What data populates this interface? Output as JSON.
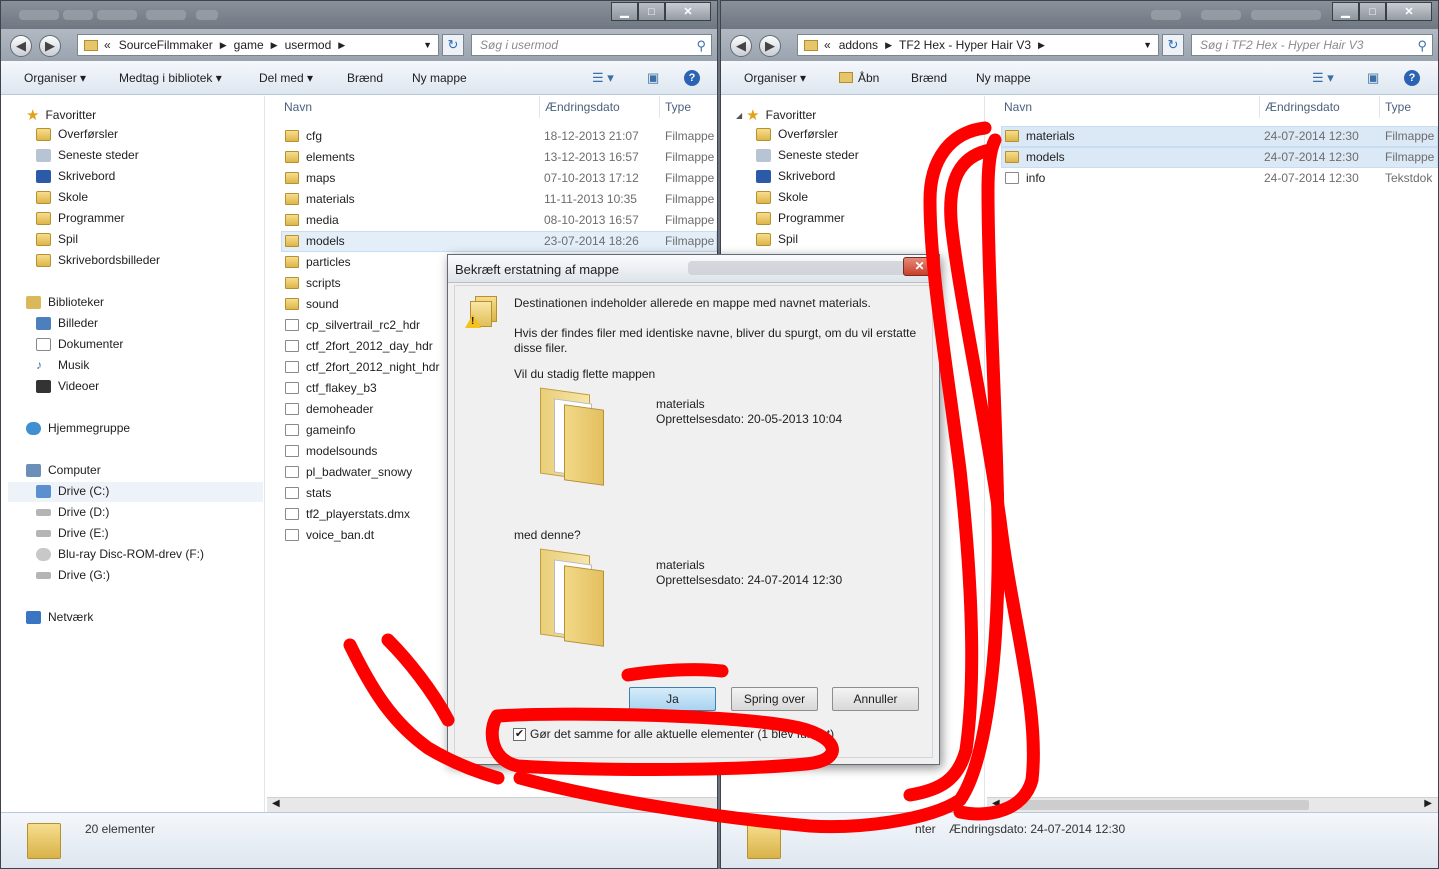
{
  "left_window": {
    "address": [
      "SourceFilmmaker",
      "game",
      "usermod"
    ],
    "search_placeholder": "Søg i usermod",
    "toolbar": {
      "organize": "Organiser",
      "library": "Medtag i bibliotek",
      "share": "Del med",
      "burn": "Brænd",
      "new_folder": "Ny mappe"
    },
    "nav": {
      "favorites_label": "Favoritter",
      "favorites": [
        "Overførsler",
        "Seneste steder",
        "Skrivebord",
        "Skole",
        "Programmer",
        "Spil",
        "Skrivebordsbilleder"
      ],
      "libraries_label": "Biblioteker",
      "libraries": [
        "Billeder",
        "Dokumenter",
        "Musik",
        "Videoer"
      ],
      "homegroup": "Hjemmegruppe",
      "computer_label": "Computer",
      "drives": [
        "Drive (C:)",
        "Drive  (D:)",
        "Drive (E:)",
        "Blu-ray Disc-ROM-drev (F:)",
        "Drive (G:)"
      ],
      "network": "Netværk"
    },
    "columns": {
      "name": "Navn",
      "date": "Ændringsdato",
      "type": "Type"
    },
    "files": [
      {
        "name": "cfg",
        "date": "18-12-2013 21:07",
        "type": "Filmappe"
      },
      {
        "name": "elements",
        "date": "13-12-2013 16:57",
        "type": "Filmappe"
      },
      {
        "name": "maps",
        "date": "07-10-2013 17:12",
        "type": "Filmappe"
      },
      {
        "name": "materials",
        "date": "11-11-2013 10:35",
        "type": "Filmappe"
      },
      {
        "name": "media",
        "date": "08-10-2013 16:57",
        "type": "Filmappe"
      },
      {
        "name": "models",
        "date": "23-07-2014 18:26",
        "type": "Filmappe"
      },
      {
        "name": "particles"
      },
      {
        "name": "scripts"
      },
      {
        "name": "sound"
      },
      {
        "name": "cp_silvertrail_rc2_hdr"
      },
      {
        "name": "ctf_2fort_2012_day_hdr"
      },
      {
        "name": "ctf_2fort_2012_night_hdr"
      },
      {
        "name": "ctf_flakey_b3"
      },
      {
        "name": "demoheader"
      },
      {
        "name": "gameinfo"
      },
      {
        "name": "modelsounds"
      },
      {
        "name": "pl_badwater_snowy"
      },
      {
        "name": "stats"
      },
      {
        "name": "tf2_playerstats.dmx"
      },
      {
        "name": "voice_ban.dt"
      }
    ],
    "status": "20 elementer"
  },
  "right_window": {
    "address": [
      "addons",
      "TF2 Hex - Hyper Hair V3"
    ],
    "search_placeholder": "Søg i TF2 Hex - Hyper Hair V3",
    "toolbar": {
      "organize": "Organiser",
      "open": "Åbn",
      "burn": "Brænd",
      "new_folder": "Ny mappe"
    },
    "nav": {
      "favorites_label": "Favoritter",
      "favorites": [
        "Overførsler",
        "Seneste steder",
        "Skrivebord",
        "Skole",
        "Programmer",
        "Spil"
      ]
    },
    "columns": {
      "name": "Navn",
      "date": "Ændringsdato",
      "type": "Type"
    },
    "files": [
      {
        "name": "materials",
        "date": "24-07-2014 12:30",
        "type": "Filmappe"
      },
      {
        "name": "models",
        "date": "24-07-2014 12:30",
        "type": "Filmappe"
      },
      {
        "name": "info",
        "date": "24-07-2014 12:30",
        "type": "Tekstdok"
      }
    ],
    "status_tail": "nter",
    "status_date": "Ændringsdato: 24-07-2014 12:30"
  },
  "dialog": {
    "title": "Bekræft erstatning af mappe",
    "line1": "Destinationen indeholder allerede en mappe med navnet materials.",
    "line2a": "Hvis der findes filer med identiske navne, bliver du spurgt, om du vil erstatte",
    "line2b": "disse filer.",
    "line3": "Vil du stadig flette mappen",
    "existing": {
      "name": "materials",
      "created": "Oprettelsesdato: 20-05-2013 10:04"
    },
    "with_this": "med denne?",
    "incoming": {
      "name": "materials",
      "created": "Oprettelsesdato: 24-07-2014 12:30"
    },
    "buttons": {
      "yes": "Ja",
      "skip": "Spring over",
      "cancel": "Annuller"
    },
    "checkbox": "Gør det samme for alle aktuelle elementer (1 blev fundet)",
    "checked": true
  },
  "colors": {
    "annotation": "#ff0000",
    "folder": "#e6c56b",
    "selection": "#e3eef9"
  }
}
